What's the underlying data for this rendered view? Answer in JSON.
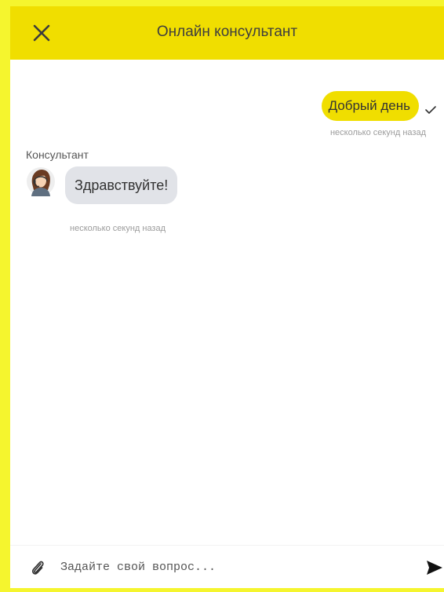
{
  "header": {
    "title": "Онлайн консультант",
    "close_icon": "close-icon",
    "background": "#f0de00"
  },
  "messages": [
    {
      "direction": "outgoing",
      "text": "Добрый день",
      "status_icon": "check-icon",
      "time": "несколько секунд назад",
      "bubble_color": "#f0de00"
    },
    {
      "direction": "incoming",
      "sender": "Консультант",
      "avatar_icon": "consultant-avatar",
      "text": "Здравствуйте!",
      "time": "несколько секунд назад",
      "bubble_color": "#e1e3e8"
    }
  ],
  "composer": {
    "placeholder": "Задайте свой вопрос...",
    "value": "",
    "attach_icon": "paperclip-icon",
    "send_icon": "send-icon"
  },
  "page_background": "#f5f52e"
}
